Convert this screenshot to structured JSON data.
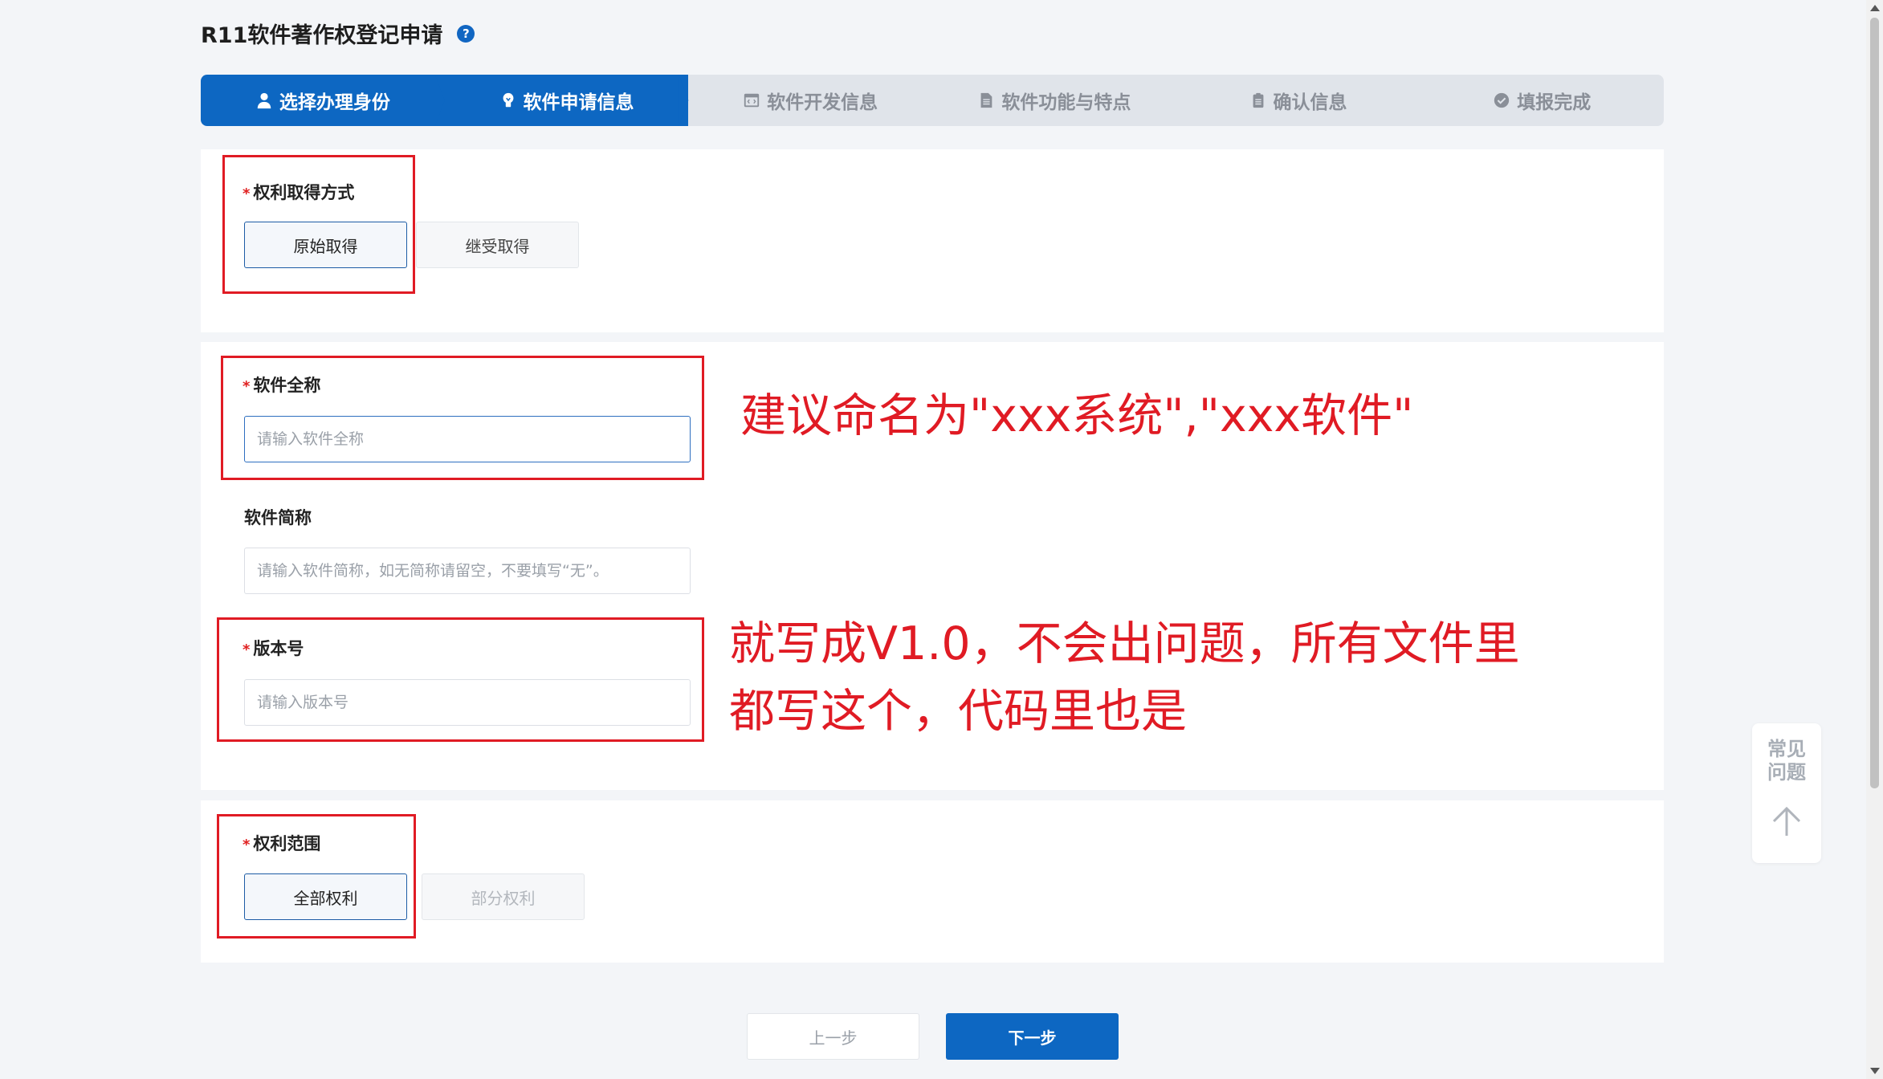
{
  "page": {
    "title": "R11软件著作权登记申请",
    "help_icon_glyph": "?"
  },
  "steps": [
    {
      "label": "选择办理身份",
      "icon": "user-icon",
      "active": true
    },
    {
      "label": "软件申请信息",
      "icon": "bulb-icon",
      "active": true
    },
    {
      "label": "软件开发信息",
      "icon": "code-window-icon",
      "active": false
    },
    {
      "label": "软件功能与特点",
      "icon": "document-icon",
      "active": false
    },
    {
      "label": "确认信息",
      "icon": "clipboard-icon",
      "active": false
    },
    {
      "label": "填报完成",
      "icon": "check-circle-icon",
      "active": false
    }
  ],
  "rights_acquisition": {
    "required_mark": "*",
    "label": "权利取得方式",
    "options": [
      "原始取得",
      "继受取得"
    ],
    "selected": "原始取得"
  },
  "software_full_name": {
    "required_mark": "*",
    "label": "软件全称",
    "placeholder": "请输入软件全称",
    "value": ""
  },
  "software_short_name": {
    "label": "软件简称",
    "placeholder": "请输入软件简称，如无简称请留空，不要填写“无”。",
    "value": ""
  },
  "version": {
    "required_mark": "*",
    "label": "版本号",
    "placeholder": "请输入版本号",
    "value": ""
  },
  "rights_scope": {
    "required_mark": "*",
    "label": "权利范围",
    "options": [
      "全部权利",
      "部分权利"
    ],
    "selected": "全部权利"
  },
  "annotations": {
    "name_hint": "建议命名为\"xxx系统\",\"xxx软件\"",
    "version_hint_line1": "就写成V1.0，不会出问题，所有文件里",
    "version_hint_line2": "都写这个，代码里也是"
  },
  "footer": {
    "prev_label": "上一步",
    "next_label": "下一步"
  },
  "faq_widget": {
    "label": "常见问题",
    "icon": "arrow-up-icon"
  },
  "colors": {
    "primary": "#0d67c2",
    "annotation_red": "#e01b24",
    "required_red": "#e02020"
  }
}
